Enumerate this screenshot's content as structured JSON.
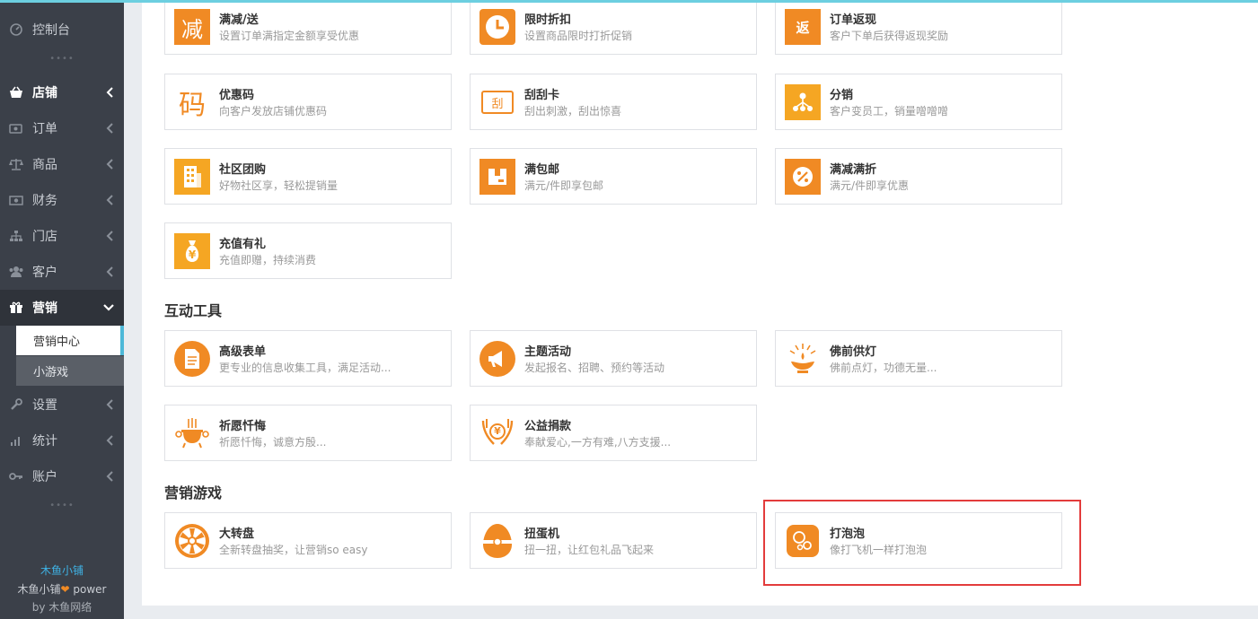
{
  "sidebar": {
    "items": [
      {
        "label": "控制台",
        "icon": "dashboard-icon"
      },
      {
        "label": "店铺",
        "icon": "basket-icon"
      },
      {
        "label": "订单",
        "icon": "order-icon"
      },
      {
        "label": "商品",
        "icon": "scale-icon"
      },
      {
        "label": "财务",
        "icon": "money-icon"
      },
      {
        "label": "门店",
        "icon": "sitemap-icon"
      },
      {
        "label": "客户",
        "icon": "users-icon"
      },
      {
        "label": "营销",
        "icon": "gift-icon"
      },
      {
        "label": "设置",
        "icon": "wrench-icon"
      },
      {
        "label": "统计",
        "icon": "bar-chart-icon"
      },
      {
        "label": "账户",
        "icon": "key-icon"
      }
    ],
    "submenu": [
      {
        "label": "营销中心"
      },
      {
        "label": "小游戏"
      }
    ],
    "dots": "••••",
    "footer": {
      "brand": "木鱼小铺",
      "power_prefix": "木鱼小铺",
      "power_suffix": " power",
      "by": "by 木鱼网络"
    }
  },
  "sections": {
    "interactive": "互动工具",
    "games": "营销游戏"
  },
  "cards": {
    "mjs": {
      "title": "满减/送",
      "desc": "设置订单满指定金额享受优惠",
      "glyph": "减"
    },
    "xszk": {
      "title": "限时折扣",
      "desc": "设置商品限时打折促销"
    },
    "ddfx": {
      "title": "订单返现",
      "desc": "客户下单后获得返现奖励",
      "glyph": "返"
    },
    "yhm": {
      "title": "优惠码",
      "desc": "向客户发放店铺优惠码",
      "glyph": "码"
    },
    "ggk": {
      "title": "刮刮卡",
      "desc": "刮出刺激，刮出惊喜",
      "glyph": "刮"
    },
    "fx": {
      "title": "分销",
      "desc": "客户变员工，销量噌噌噌"
    },
    "sqtg": {
      "title": "社区团购",
      "desc": "好物社区享，轻松提销量"
    },
    "mby": {
      "title": "满包邮",
      "desc": "满元/件即享包邮"
    },
    "mjmz": {
      "title": "满减满折",
      "desc": "满元/件即享优惠"
    },
    "czyl": {
      "title": "充值有礼",
      "desc": "充值即赠，持续消费",
      "glyph": "¥"
    },
    "gjbd": {
      "title": "高级表单",
      "desc": "更专业的信息收集工具，满足活动..."
    },
    "zthd": {
      "title": "主题活动",
      "desc": "发起报名、招聘、预约等活动"
    },
    "fqgd": {
      "title": "佛前供灯",
      "desc": "佛前点灯，功德无量..."
    },
    "qych": {
      "title": "祈愿忏悔",
      "desc": "祈愿忏悔，诚意方殷..."
    },
    "gyjk": {
      "title": "公益捐款",
      "desc": "奉献爱心,一方有难,八方支援...",
      "glyph": "¥"
    },
    "dzp": {
      "title": "大转盘",
      "desc": "全新转盘抽奖，让营销so easy"
    },
    "ndj": {
      "title": "扭蛋机",
      "desc": "扭一扭，让红包礼品飞起来"
    },
    "dpp": {
      "title": "打泡泡",
      "desc": "像打飞机一样打泡泡"
    }
  },
  "colors": {
    "accent": "#f08a24",
    "sidebar_bg": "#3b4049",
    "highlight_border": "#e33c3c",
    "brand_link": "#3fb3e6",
    "heart": "#f08a24"
  }
}
